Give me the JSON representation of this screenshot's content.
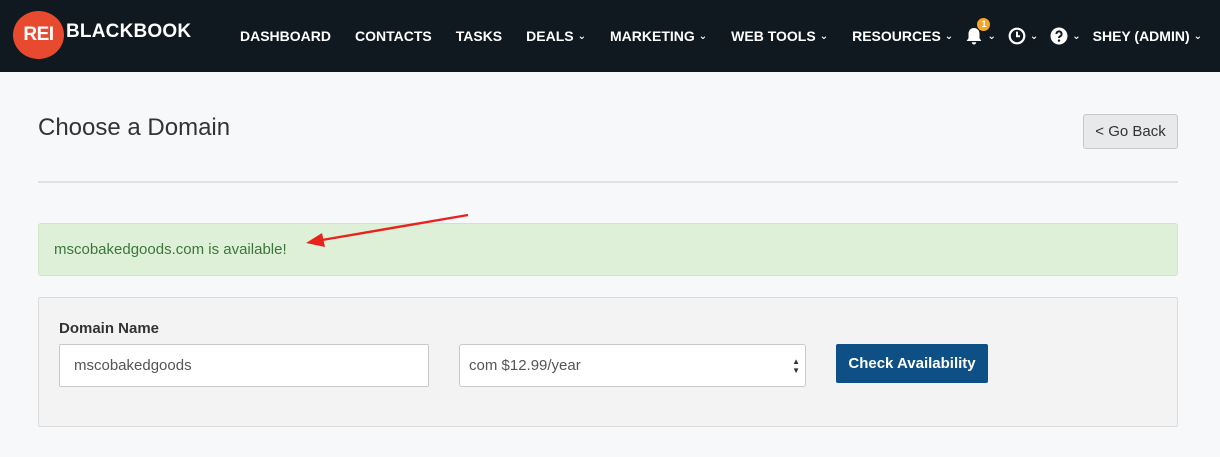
{
  "brand": {
    "badge": "REI",
    "word": "BLACKBOOK"
  },
  "nav": {
    "items": [
      {
        "label": "DASHBOARD",
        "dropdown": false
      },
      {
        "label": "CONTACTS",
        "dropdown": false
      },
      {
        "label": "TASKS",
        "dropdown": false
      },
      {
        "label": "DEALS",
        "dropdown": true
      },
      {
        "label": "MARKETING",
        "dropdown": true
      },
      {
        "label": "WEB TOOLS",
        "dropdown": true
      },
      {
        "label": "RESOURCES",
        "dropdown": true
      }
    ],
    "notifications_count": "1",
    "user_label": "SHEY (ADMIN)"
  },
  "page": {
    "title": "Choose a Domain",
    "back_label": "< Go Back"
  },
  "alert": {
    "message": "mscobakedgoods.com is available!"
  },
  "form": {
    "domain_label": "Domain Name",
    "domain_value": "mscobakedgoods",
    "tld_selected": "com $12.99/year",
    "check_label": "Check Availability"
  },
  "colors": {
    "topbar": "#101820",
    "logo": "#e84a2f",
    "alert_bg": "#dff0d8",
    "alert_text": "#3c763d",
    "primary_button": "#0e4f86",
    "annotation_arrow": "#e8231e",
    "badge": "#f5a623"
  }
}
